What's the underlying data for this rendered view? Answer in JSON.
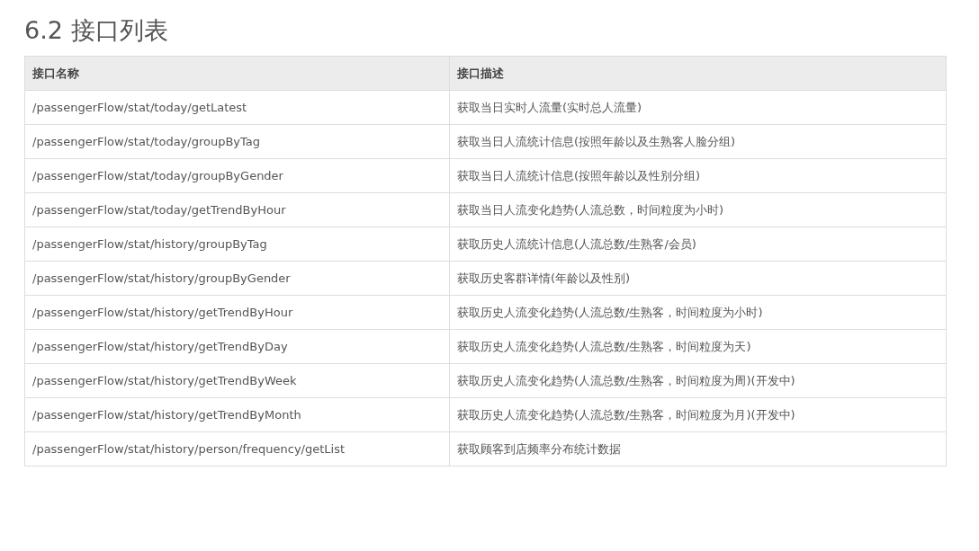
{
  "heading": "6.2 接口列表",
  "table": {
    "columns": [
      "接口名称",
      "接口描述"
    ],
    "rows": [
      [
        "/passengerFlow/stat/today/getLatest",
        "获取当日实时人流量(实时总人流量)"
      ],
      [
        "/passengerFlow/stat/today/groupByTag",
        "获取当日人流统计信息(按照年龄以及生熟客人脸分组)"
      ],
      [
        "/passengerFlow/stat/today/groupByGender",
        "获取当日人流统计信息(按照年龄以及性别分组)"
      ],
      [
        "/passengerFlow/stat/today/getTrendByHour",
        "获取当日人流变化趋势(人流总数，时间粒度为小时)"
      ],
      [
        "/passengerFlow/stat/history/groupByTag",
        "获取历史人流统计信息(人流总数/生熟客/会员)"
      ],
      [
        "/passengerFlow/stat/history/groupByGender",
        "获取历史客群详情(年龄以及性别)"
      ],
      [
        "/passengerFlow/stat/history/getTrendByHour",
        "获取历史人流变化趋势(人流总数/生熟客，时间粒度为小时)"
      ],
      [
        "/passengerFlow/stat/history/getTrendByDay",
        "获取历史人流变化趋势(人流总数/生熟客，时间粒度为天)"
      ],
      [
        "/passengerFlow/stat/history/getTrendByWeek",
        "获取历史人流变化趋势(人流总数/生熟客，时间粒度为周)(开发中)"
      ],
      [
        "/passengerFlow/stat/history/getTrendByMonth",
        "获取历史人流变化趋势(人流总数/生熟客，时间粒度为月)(开发中)"
      ],
      [
        "/passengerFlow/stat/history/person/frequency/getList",
        "获取顾客到店频率分布统计数据"
      ]
    ]
  }
}
